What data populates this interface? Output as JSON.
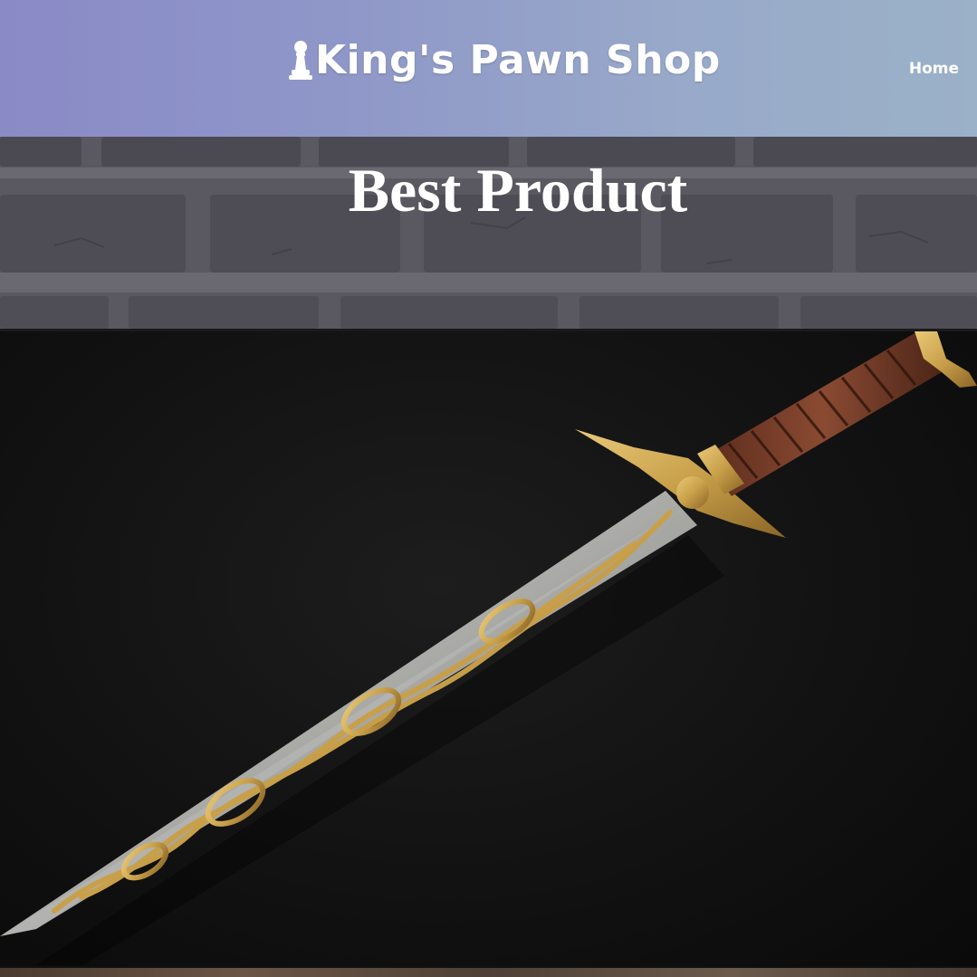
{
  "header": {
    "brand_name": "King's Pawn Shop",
    "brand_icon": "pawn-icon",
    "nav": {
      "home_label": "Home"
    }
  },
  "hero": {
    "title": "Best Product",
    "background": "brick-wall"
  },
  "product": {
    "image": "ornate-sword-image"
  },
  "colors": {
    "header_gradient_start": "#8a8ac7",
    "header_gradient_end": "#9bb1c8",
    "hero_text": "#ffffff",
    "product_background": "#121212",
    "gold": "#c9a04a"
  }
}
